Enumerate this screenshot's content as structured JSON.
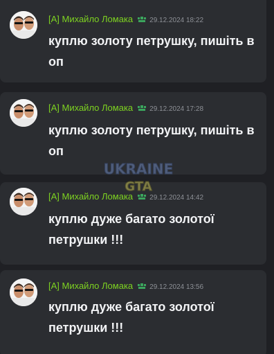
{
  "messages": [
    {
      "author": "[A] Михайло Ломака",
      "timestamp": "29.12.2024 18:22",
      "text": "куплю золоту петрушку, пишіть в оп"
    },
    {
      "author": "[A] Михайло Ломака",
      "timestamp": "29.12.2024 17:28",
      "text": "куплю золоту петрушку, пишіть в оп"
    },
    {
      "author": "[A] Михайло Ломака",
      "timestamp": "29.12.2024 14:42",
      "text": "куплю дуже багато золотої петрушки !!!"
    },
    {
      "author": "[A] Михайло Ломака",
      "timestamp": "29.12.2024 13:56",
      "text": "куплю дуже багато золотої петрушки !!!"
    }
  ],
  "role_icon": "admin-badge-icon",
  "watermark": {
    "line1": "UKRAINE",
    "line2": "GTA"
  },
  "colors": {
    "background": "#1f2024",
    "card": "#2b2d31",
    "author": "#7ed321",
    "timestamp": "#8d9096",
    "message": "#f2f3f5"
  }
}
